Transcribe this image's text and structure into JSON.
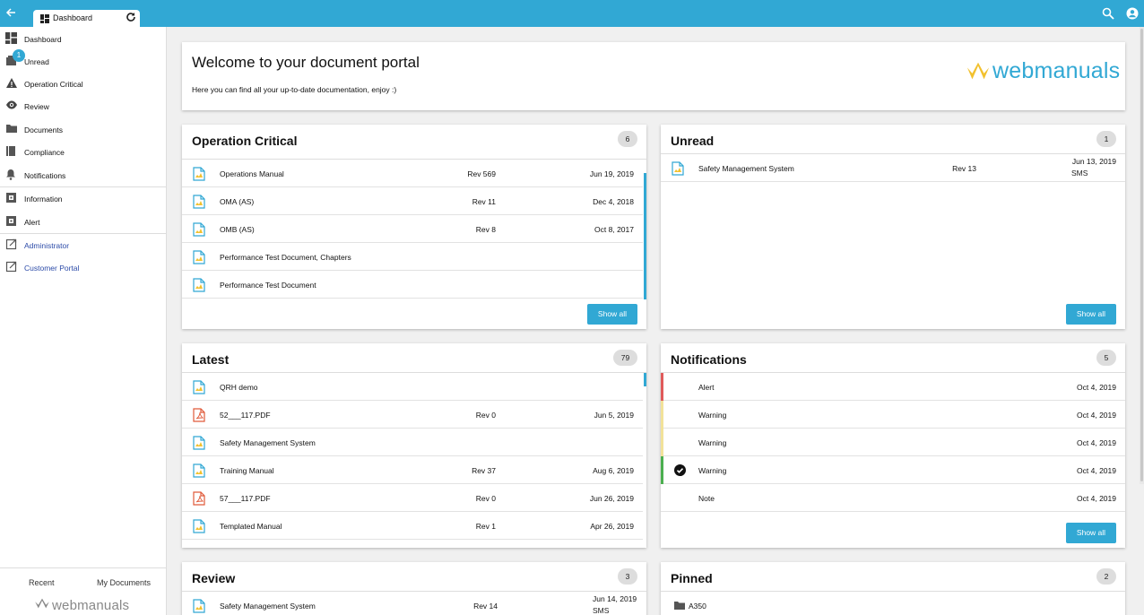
{
  "colors": {
    "accent": "#31a8d4",
    "alert": "#e05a5a",
    "warning": "#f2e29a",
    "ok": "#4caf50"
  },
  "tab": {
    "label": "Dashboard"
  },
  "sidebar": {
    "items": [
      {
        "label": "Dashboard",
        "icon": "dashboard-icon"
      },
      {
        "label": "Unread",
        "icon": "unread-icon",
        "badge": "1"
      },
      {
        "label": "Operation Critical",
        "icon": "warning-icon"
      },
      {
        "label": "Review",
        "icon": "eye-icon"
      },
      {
        "label": "Documents",
        "icon": "folder-icon"
      },
      {
        "label": "Compliance",
        "icon": "book-icon"
      },
      {
        "label": "Notifications",
        "icon": "bell-icon"
      },
      {
        "label": "Information",
        "icon": "info-icon"
      },
      {
        "label": "Alert",
        "icon": "alert-icon"
      },
      {
        "label": "Administrator",
        "icon": "external-link-icon"
      },
      {
        "label": "Customer Portal",
        "icon": "external-link-icon"
      }
    ],
    "recent": "Recent",
    "my_documents": "My Documents",
    "logo_text": "webmanuals"
  },
  "welcome": {
    "title": "Welcome to your document portal",
    "subtitle": "Here you can find all your up-to-date documentation, enjoy :)",
    "logo_text": "webmanuals"
  },
  "operation_critical": {
    "title": "Operation Critical",
    "count": "6",
    "show_all": "Show all",
    "rows": [
      {
        "name": "Operations Manual",
        "rev": "Rev 569",
        "date": "Jun 19, 2019"
      },
      {
        "name": "OMA (AS)",
        "rev": "Rev 11",
        "date": "Dec 4, 2018"
      },
      {
        "name": "OMB (AS)",
        "rev": "Rev 8",
        "date": "Oct 8, 2017"
      },
      {
        "name": "Performance Test Document, Chapters",
        "rev": "",
        "date": ""
      },
      {
        "name": "Performance Test Document",
        "rev": "",
        "date": ""
      }
    ]
  },
  "unread": {
    "title": "Unread",
    "count": "1",
    "show_all": "Show all",
    "rows": [
      {
        "name": "Safety Management System",
        "rev": "Rev 13",
        "date": "Jun 13, 2019",
        "tag": "SMS"
      }
    ]
  },
  "latest": {
    "title": "Latest",
    "count": "79",
    "rows": [
      {
        "name": "QRH demo",
        "rev": "",
        "date": "",
        "type": "doc"
      },
      {
        "name": "52___117.PDF",
        "rev": "Rev 0",
        "date": "Jun 5, 2019",
        "type": "pdf"
      },
      {
        "name": "Safety Management System",
        "rev": "",
        "date": "",
        "type": "doc"
      },
      {
        "name": "Training Manual",
        "rev": "Rev 37",
        "date": "Aug 6, 2019",
        "type": "doc"
      },
      {
        "name": "57___117.PDF",
        "rev": "Rev 0",
        "date": "Jun 26, 2019",
        "type": "pdf"
      },
      {
        "name": "Templated Manual",
        "rev": "Rev 1",
        "date": "Apr 26, 2019",
        "type": "doc"
      }
    ]
  },
  "notifications": {
    "title": "Notifications",
    "count": "5",
    "show_all": "Show all",
    "rows": [
      {
        "name": "Alert",
        "date": "Oct 4, 2019",
        "level": "alert"
      },
      {
        "name": "Warning",
        "date": "Oct 4, 2019",
        "level": "warning"
      },
      {
        "name": "Warning",
        "date": "Oct 4, 2019",
        "level": "warning"
      },
      {
        "name": "Warning",
        "date": "Oct 4, 2019",
        "level": "ok",
        "checked": true
      },
      {
        "name": "Note",
        "date": "Oct 4, 2019",
        "level": "none"
      }
    ]
  },
  "review": {
    "title": "Review",
    "count": "3",
    "rows": [
      {
        "name": "Safety Management System",
        "rev": "Rev 14",
        "date": "Jun 14, 2019",
        "tag": "SMS"
      }
    ]
  },
  "pinned": {
    "title": "Pinned",
    "count": "2",
    "rows": [
      {
        "name": "A350"
      }
    ]
  }
}
